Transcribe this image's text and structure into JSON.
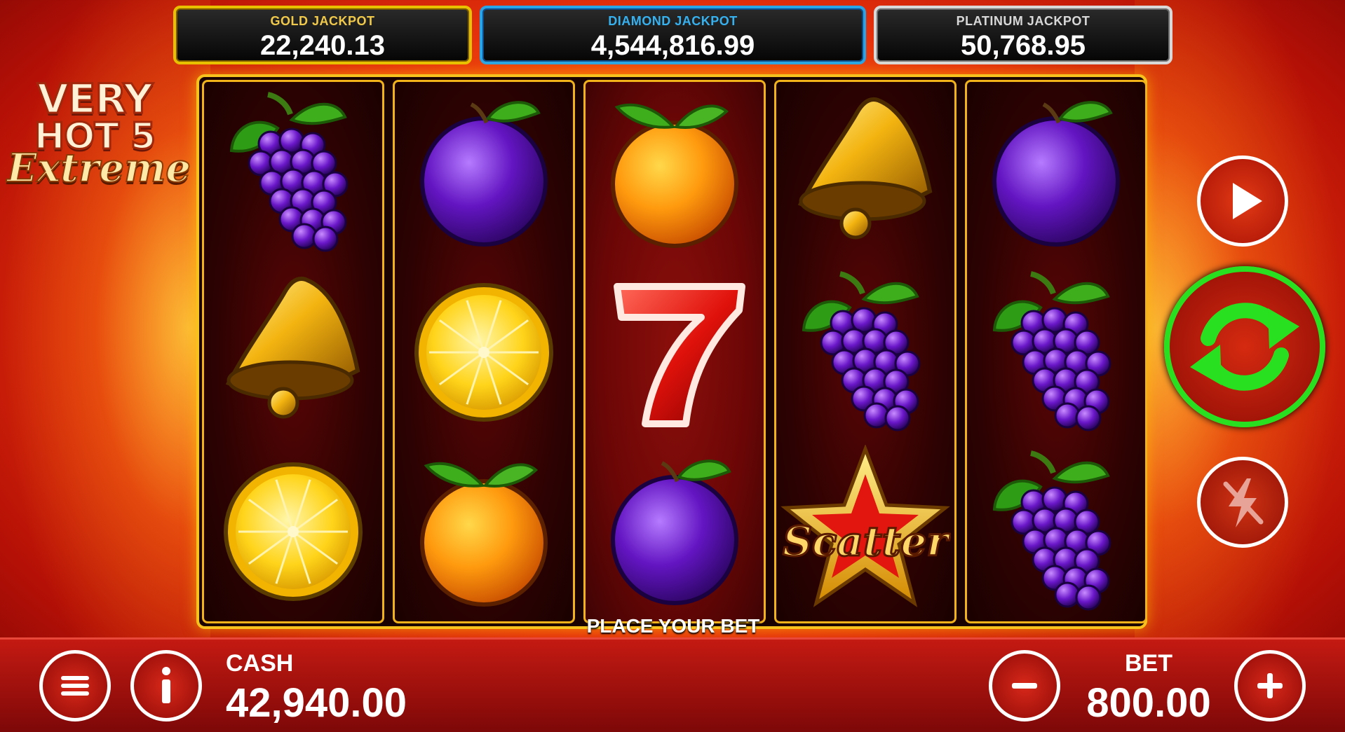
{
  "jackpots": {
    "gold": {
      "label": "GOLD JACKPOT",
      "value": "22,240.13"
    },
    "diamond": {
      "label": "DIAMOND JACKPOT",
      "value": "4,544,816.99"
    },
    "platinum": {
      "label": "PLATINUM JACKPOT",
      "value": "50,768.95"
    }
  },
  "logo": {
    "line1": "VERY",
    "line2": "HOT 5",
    "line3": "Extreme"
  },
  "reels": [
    [
      "grapes",
      "bell",
      "lemon"
    ],
    [
      "plum",
      "lemon",
      "orange"
    ],
    [
      "orange",
      "seven",
      "plum"
    ],
    [
      "bell",
      "grapes",
      "scatter"
    ],
    [
      "plum",
      "grapes",
      "grapes"
    ]
  ],
  "scatter_text": "Scatter",
  "status_message": "PLACE YOUR BET",
  "cash": {
    "label": "CASH",
    "value": "42,940.00"
  },
  "bet": {
    "label": "BET",
    "value": "800.00"
  },
  "controls": {
    "play": "play-icon",
    "spin": "spin-arrows-icon",
    "turbo": "lightning-off-icon",
    "menu": "menu-icon",
    "info": "info-icon",
    "minus": "minus-icon",
    "plus": "plus-icon"
  },
  "colors": {
    "gold_border": "#e8c200",
    "diamond_border": "#27a5e8",
    "platinum_border": "#d9d9d9",
    "spin_ring": "#28e01f",
    "reel_frame": "#f7c21e"
  }
}
